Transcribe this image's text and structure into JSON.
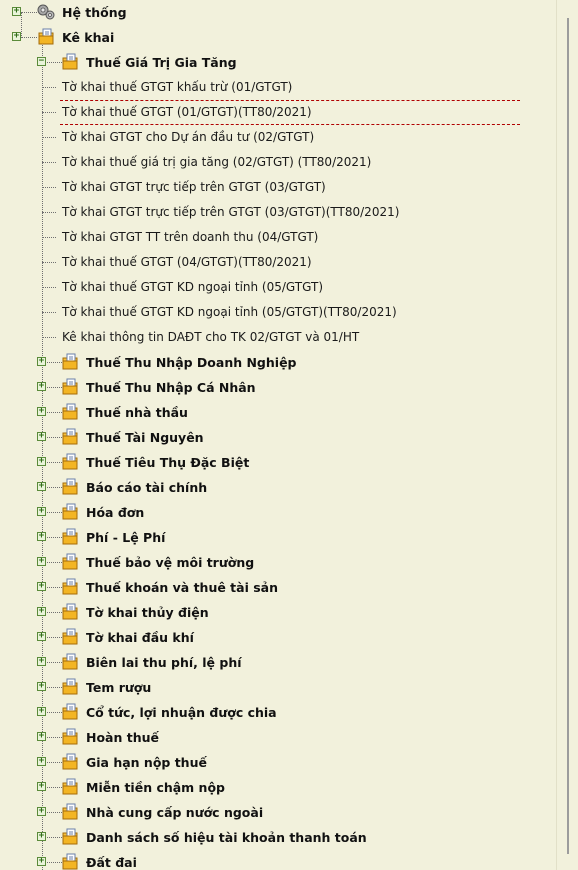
{
  "tree": {
    "root_items": [
      {
        "label": "Hệ thống",
        "icon": "gear-icon",
        "expander": "+"
      },
      {
        "label": "Kê khai",
        "icon": "folder-icon",
        "expander": "+"
      }
    ],
    "expanded_group": {
      "label": "Thuế Giá Trị Gia Tăng",
      "expander": "−"
    },
    "leaves": [
      "Tờ khai thuế GTGT khấu trừ (01/GTGT)",
      "Tờ khai thuế GTGT (01/GTGT)(TT80/2021)",
      "Tờ khai GTGT cho Dự án đầu tư (02/GTGT)",
      "Tờ khai thuế giá trị gia tăng (02/GTGT) (TT80/2021)",
      "Tờ khai GTGT trực tiếp trên GTGT (03/GTGT)",
      "Tờ khai GTGT trực tiếp trên GTGT (03/GTGT)(TT80/2021)",
      "Tờ khai GTGT TT trên doanh thu (04/GTGT)",
      "Tờ khai thuế GTGT (04/GTGT)(TT80/2021)",
      "Tờ khai thuế GTGT KD ngoại tỉnh (05/GTGT)",
      "Tờ khai thuế GTGT KD ngoại tỉnh (05/GTGT)(TT80/2021)",
      "Kê khai thông tin DAĐT cho TK 02/GTGT và 01/HT"
    ],
    "selected_leaf_index": 1,
    "groups": [
      "Thuế Thu Nhập Doanh Nghiệp",
      "Thuế Thu Nhập Cá Nhân",
      "Thuế nhà thầu",
      "Thuế Tài Nguyên",
      "Thuế Tiêu Thụ Đặc Biệt",
      "Báo cáo tài chính",
      "Hóa đơn",
      "Phí - Lệ Phí",
      "Thuế bảo vệ môi trường",
      "Thuế khoán và thuê tài sản",
      "Tờ khai thủy điện",
      "Tờ khai đầu khí",
      "Biên lai thu phí, lệ phí",
      "Tem rượu",
      "Cổ tức, lợi nhuận được chia",
      "Hoàn thuế",
      "Gia hạn nộp thuế",
      "Miễn tiền chậm nộp",
      "Nhà cung cấp nước ngoài",
      "Danh sách số hiệu tài khoản thanh toán",
      "Đất đai"
    ],
    "group_expander": "+"
  }
}
